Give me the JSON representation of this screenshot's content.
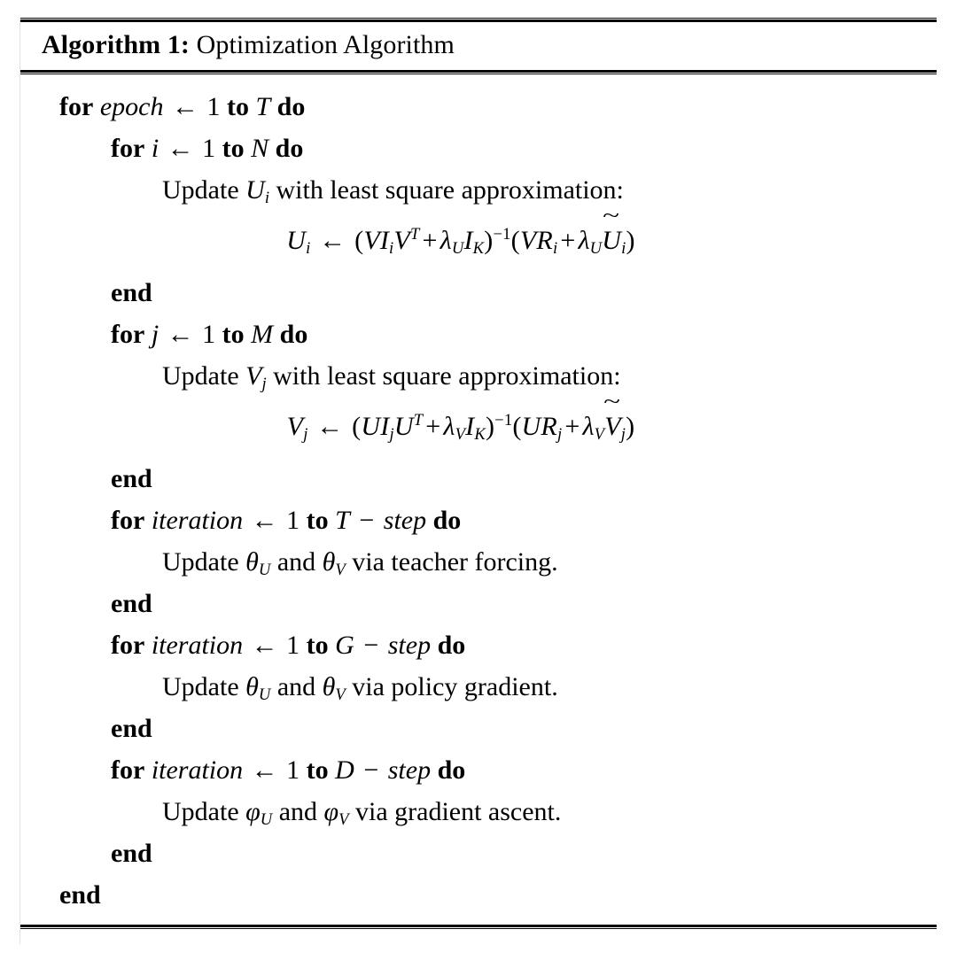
{
  "algorithm": {
    "caption_label": "Algorithm 1:",
    "caption_text": " Optimization Algorithm",
    "lines": [
      {
        "id": "l1",
        "level": 0,
        "type": "for",
        "text": "for epoch ← 1 to T do"
      },
      {
        "id": "l2",
        "level": 1,
        "type": "for",
        "text": "for i ← 1 to N do"
      },
      {
        "id": "l3",
        "level": 2,
        "type": "stmt",
        "text": "Update Uᵢ with least square approximation:"
      },
      {
        "id": "l4",
        "level": 2,
        "type": "eq",
        "text": "Uᵢ ← (VIᵢVᵀ + λᵤIₖ)⁻¹(VRᵢ + λᵤŨᵢ)"
      },
      {
        "id": "l5",
        "level": 1,
        "type": "end",
        "text": "end"
      },
      {
        "id": "l6",
        "level": 1,
        "type": "for",
        "text": "for j ← 1 to M do"
      },
      {
        "id": "l7",
        "level": 2,
        "type": "stmt",
        "text": "Update Vⱼ with least square approximation:"
      },
      {
        "id": "l8",
        "level": 2,
        "type": "eq",
        "text": "Vⱼ ← (UIⱼUᵀ + λᵥIₖ)⁻¹(URⱼ + λᵥṼⱼ)"
      },
      {
        "id": "l9",
        "level": 1,
        "type": "end",
        "text": "end"
      },
      {
        "id": "l10",
        "level": 1,
        "type": "for",
        "text": "for iteration ← 1 to T − step do"
      },
      {
        "id": "l11",
        "level": 2,
        "type": "stmt",
        "text": "Update θᵤ and θᵥ via teacher forcing."
      },
      {
        "id": "l12",
        "level": 1,
        "type": "end",
        "text": "end"
      },
      {
        "id": "l13",
        "level": 1,
        "type": "for",
        "text": "for iteration ← 1 to G − step do"
      },
      {
        "id": "l14",
        "level": 2,
        "type": "stmt",
        "text": "Update θᵤ and θᵥ via policy gradient."
      },
      {
        "id": "l15",
        "level": 1,
        "type": "end",
        "text": "end"
      },
      {
        "id": "l16",
        "level": 1,
        "type": "for",
        "text": "for iteration ← 1 to D − step do"
      },
      {
        "id": "l17",
        "level": 2,
        "type": "stmt",
        "text": "Update φᵤ and φᵥ via gradient ascent."
      },
      {
        "id": "l18",
        "level": 1,
        "type": "end",
        "text": "end"
      },
      {
        "id": "l19",
        "level": 0,
        "type": "end",
        "text": "end"
      }
    ],
    "tokens": {
      "kw_for": "for",
      "kw_to": "to",
      "kw_do": "do",
      "kw_end": "end",
      "arrow": "←",
      "one": "1",
      "minus": "−",
      "var_epoch": "epoch",
      "var_i": "i",
      "var_j": "j",
      "var_iteration": "iteration",
      "var_step": "step",
      "bound_T": "T",
      "bound_N": "N",
      "bound_M": "M",
      "bound_G": "G",
      "bound_D": "D",
      "update": "Update",
      "with_lsq": "with least square approximation:",
      "and": "and",
      "via_teacher": "via teacher forcing.",
      "via_policy": "via policy gradient.",
      "via_ascent": "via gradient ascent.",
      "sym_U": "U",
      "sym_V": "V",
      "sym_I": "I",
      "sym_R": "R",
      "sym_K": "K",
      "sym_T_sup": "T",
      "sym_lambda": "λ",
      "sym_theta": "θ",
      "sym_phi": "φ",
      "sub_i": "i",
      "sub_j": "j",
      "sub_U": "U",
      "sub_V": "V",
      "inv": "−1",
      "tilde": "~",
      "plus": "+",
      "lparen": "(",
      "rparen": ")"
    },
    "colors": {
      "text": "#000000",
      "background": "#ffffff",
      "rule": "#000000"
    }
  }
}
